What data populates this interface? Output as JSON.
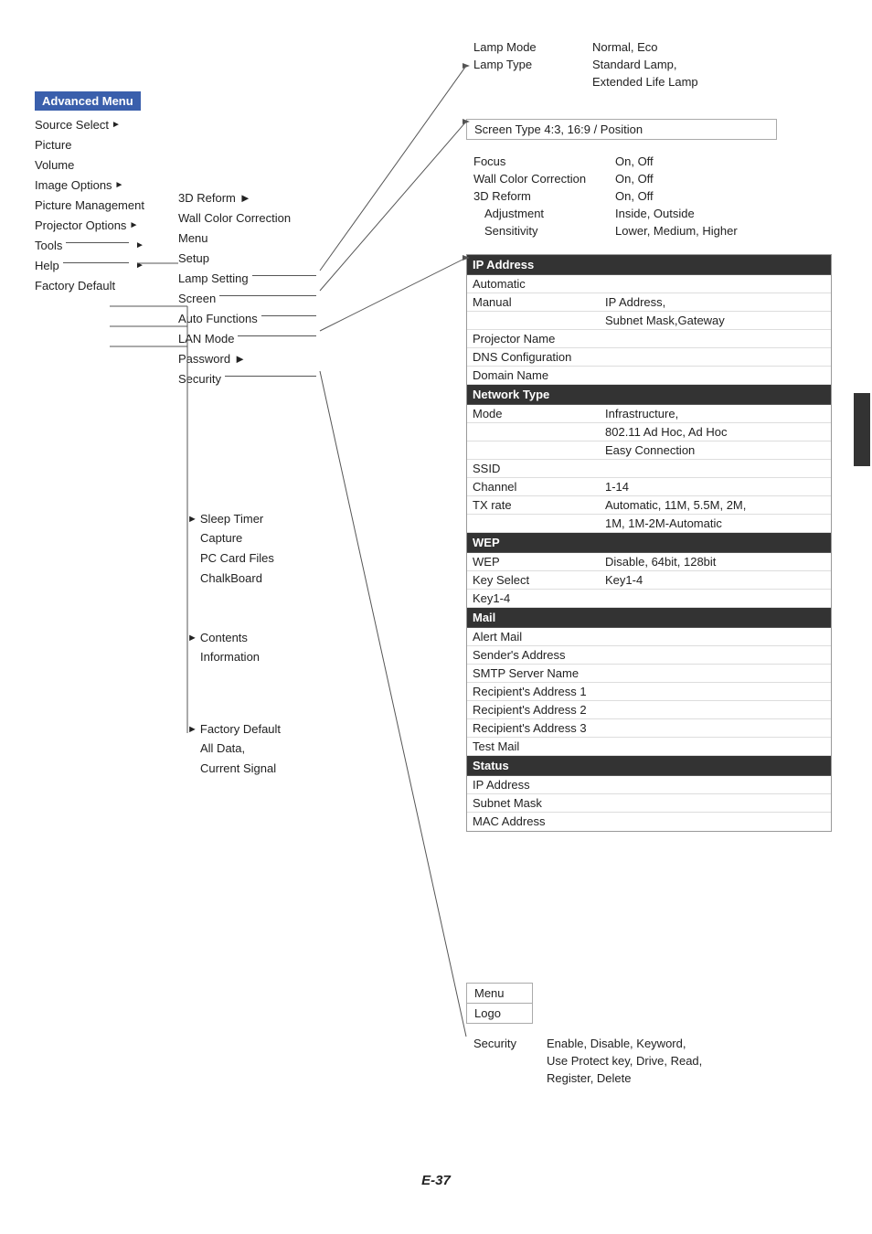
{
  "page": {
    "number": "E-37"
  },
  "advanced_menu": {
    "title": "Advanced Menu",
    "items": [
      {
        "label": "Source Select",
        "arrow": true
      },
      {
        "label": "Picture",
        "arrow": false
      },
      {
        "label": "Volume",
        "arrow": false
      },
      {
        "label": "Image Options",
        "arrow": true
      },
      {
        "label": "Picture Management",
        "arrow": false
      },
      {
        "label": "Projector Options",
        "arrow": true
      },
      {
        "label": "Tools",
        "arrow": true
      },
      {
        "label": "Help",
        "arrow": true
      },
      {
        "label": "Factory Default",
        "arrow": false
      }
    ]
  },
  "col2": {
    "items": [
      {
        "label": "3D Reform",
        "arrow": true
      },
      {
        "label": "Wall Color Correction",
        "arrow": false
      },
      {
        "label": "Menu",
        "arrow": false
      },
      {
        "label": "Setup",
        "arrow": false
      },
      {
        "label": "Lamp Setting",
        "arrow": false,
        "line": true
      },
      {
        "label": "Screen",
        "arrow": false,
        "line": true
      },
      {
        "label": "Auto Functions",
        "arrow": false,
        "line": true
      },
      {
        "label": "LAN Mode",
        "arrow": false,
        "line": true
      },
      {
        "label": "Password",
        "arrow": true
      },
      {
        "label": "Security",
        "arrow": false,
        "line": true
      }
    ]
  },
  "col2_tools": {
    "items": [
      {
        "label": "Sleep Timer"
      },
      {
        "label": "Capture"
      },
      {
        "label": "PC Card Files"
      },
      {
        "label": "ChalkBoard"
      }
    ]
  },
  "col2_help": {
    "items": [
      {
        "label": "Contents"
      },
      {
        "label": "Information"
      }
    ]
  },
  "col2_factory": {
    "items": [
      {
        "label": "Factory Default"
      },
      {
        "label": "All Data,"
      },
      {
        "label": "Current Signal"
      }
    ]
  },
  "lamp_section": {
    "rows": [
      {
        "label": "Lamp Mode",
        "value": "Normal, Eco"
      },
      {
        "label": "Lamp Type",
        "value": "Standard Lamp,"
      },
      {
        "label": "",
        "value": "Extended Life Lamp"
      }
    ]
  },
  "screen_type": {
    "value": "Screen Type 4:3, 16:9 / Position"
  },
  "projector_options_rows": [
    {
      "label": "Focus",
      "value": "On, Off"
    },
    {
      "label": "Wall Color Correction",
      "value": "On, Off"
    },
    {
      "label": "3D Reform",
      "value": "On, Off"
    },
    {
      "label": "Adjustment",
      "value": "Inside, Outside",
      "indent": true
    },
    {
      "label": "Sensitivity",
      "value": "Lower, Medium, Higher",
      "indent": true
    }
  ],
  "lan_mode_title": "LAN Mode",
  "lan_sections": [
    {
      "type": "bold_header",
      "label": "IP Address"
    },
    {
      "type": "plain",
      "label": "Automatic"
    },
    {
      "type": "key_value",
      "label": "Manual",
      "value": "IP Address,"
    },
    {
      "type": "plain",
      "label": "",
      "value": "Subnet Mask,Gateway",
      "indent": true
    },
    {
      "type": "plain",
      "label": "Projector Name"
    },
    {
      "type": "plain",
      "label": "DNS Configuration"
    },
    {
      "type": "plain",
      "label": "Domain Name"
    },
    {
      "type": "bold_header",
      "label": "Network Type"
    },
    {
      "type": "key_value",
      "label": "Mode",
      "value": "Infrastructure,"
    },
    {
      "type": "plain",
      "label": "",
      "value": "802.11 Ad Hoc, Ad Hoc",
      "indent": true
    },
    {
      "type": "plain",
      "label": "",
      "value": "Easy Connection",
      "indent": true
    },
    {
      "type": "plain",
      "label": "SSID"
    },
    {
      "type": "key_value",
      "label": "Channel",
      "value": "1-14"
    },
    {
      "type": "key_value",
      "label": "TX rate",
      "value": "Automatic, 11M, 5.5M, 2M,"
    },
    {
      "type": "plain",
      "label": "",
      "value": "1M, 1M-2M-Automatic",
      "indent": true
    },
    {
      "type": "bold_header",
      "label": "WEP"
    },
    {
      "type": "key_value",
      "label": "WEP",
      "value": "Disable, 64bit, 128bit"
    },
    {
      "type": "key_value",
      "label": "Key Select",
      "value": "Key1-4"
    },
    {
      "type": "plain",
      "label": "Key1-4"
    },
    {
      "type": "bold_header",
      "label": "Mail"
    },
    {
      "type": "plain",
      "label": "Alert Mail"
    },
    {
      "type": "plain",
      "label": "Sender's Address"
    },
    {
      "type": "plain",
      "label": "SMTP Server Name"
    },
    {
      "type": "plain",
      "label": "Recipient's Address 1"
    },
    {
      "type": "plain",
      "label": "Recipient's Address 2"
    },
    {
      "type": "plain",
      "label": "Recipient's Address 3"
    },
    {
      "type": "plain",
      "label": "Test Mail"
    },
    {
      "type": "bold_header",
      "label": "Status"
    },
    {
      "type": "plain",
      "label": "IP Address"
    },
    {
      "type": "plain",
      "label": "Subnet Mask"
    },
    {
      "type": "plain",
      "label": "MAC Address"
    }
  ],
  "menu_logo": {
    "items": [
      "Menu",
      "Logo"
    ]
  },
  "security": {
    "label": "Security",
    "value": "Enable, Disable, Keyword,",
    "value2": "Use Protect key, Drive, Read,",
    "value3": "Register, Delete"
  }
}
